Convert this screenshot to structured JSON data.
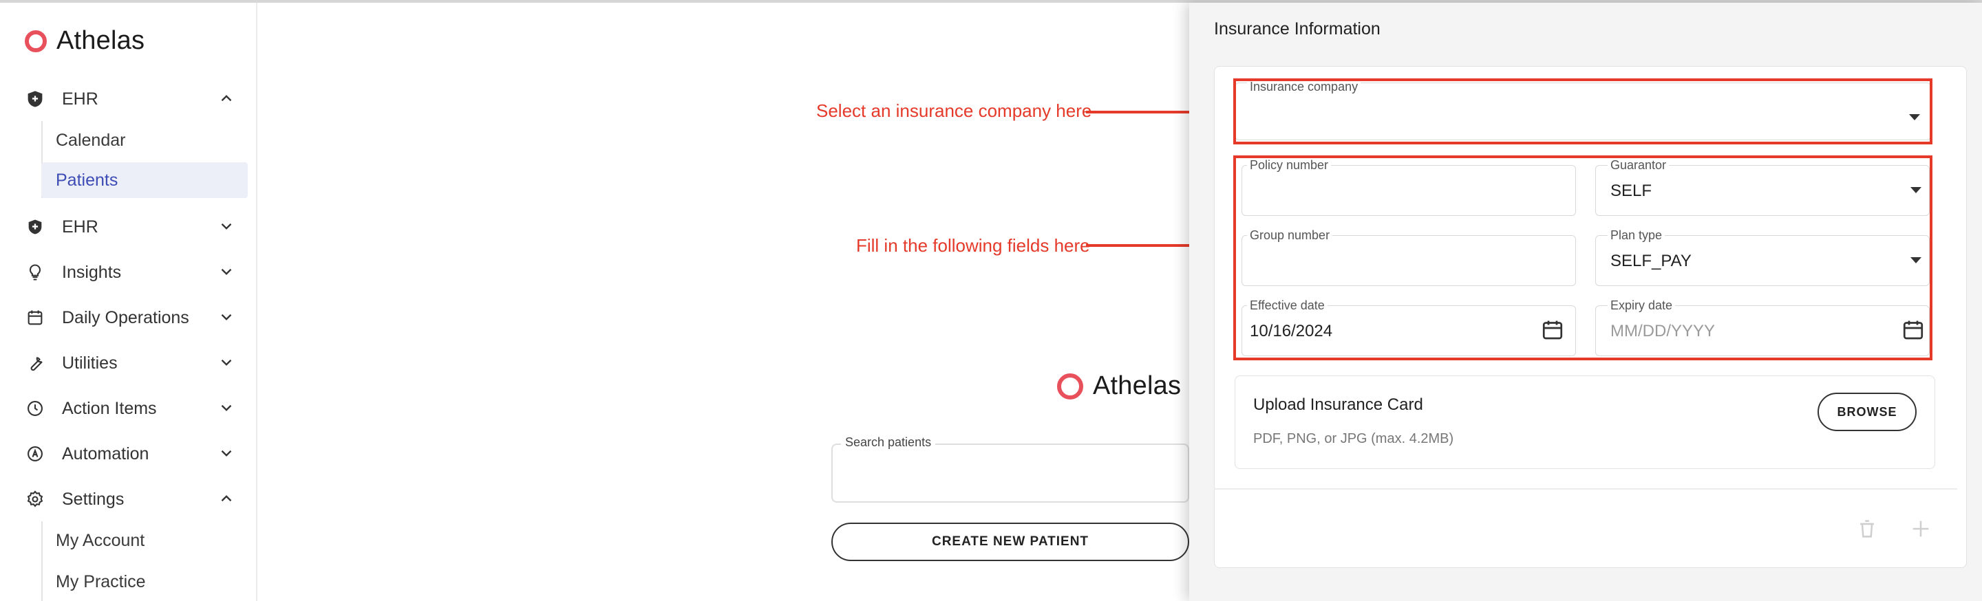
{
  "app": {
    "name": "Athelas"
  },
  "sidebar": {
    "logo_text": "Athelas",
    "items": [
      {
        "label": "EHR",
        "icon": "shield-plus-icon",
        "expanded": true
      },
      {
        "label": "EHR",
        "icon": "shield-plus-icon",
        "expanded": false
      },
      {
        "label": "Insights",
        "icon": "lightbulb-icon",
        "expanded": false
      },
      {
        "label": "Daily Operations",
        "icon": "calendar-icon",
        "expanded": false
      },
      {
        "label": "Utilities",
        "icon": "wrench-icon",
        "expanded": false
      },
      {
        "label": "Action Items",
        "icon": "clock-icon",
        "expanded": false
      },
      {
        "label": "Automation",
        "icon": "automation-icon",
        "expanded": false
      },
      {
        "label": "Settings",
        "icon": "gear-icon",
        "expanded": true
      }
    ],
    "ehr_sub": [
      {
        "label": "Calendar",
        "active": false
      },
      {
        "label": "Patients",
        "active": true
      }
    ],
    "settings_sub": [
      {
        "label": "My Account"
      },
      {
        "label": "My Practice"
      }
    ]
  },
  "main": {
    "logo_text": "Athelas",
    "search_label": "Search patients",
    "search_value": "",
    "create_button": "CREATE NEW PATIENT"
  },
  "annotations": {
    "insurance": "Select an insurance company here",
    "fields": "Fill in the following fields here"
  },
  "drawer": {
    "title": "Insurance Information",
    "insurance_company": {
      "label": "Insurance company",
      "value": ""
    },
    "policy_number": {
      "label": "Policy number",
      "value": ""
    },
    "guarantor": {
      "label": "Guarantor",
      "value": "SELF"
    },
    "group_number": {
      "label": "Group number",
      "value": ""
    },
    "plan_type": {
      "label": "Plan type",
      "value": "SELF_PAY"
    },
    "effective_date": {
      "label": "Effective date",
      "value": "10/16/2024"
    },
    "expiry_date": {
      "label": "Expiry date",
      "placeholder": "MM/DD/YYYY"
    },
    "upload": {
      "title": "Upload Insurance Card",
      "subtitle": "PDF, PNG, or JPG (max. 4.2MB)",
      "browse": "BROWSE"
    }
  },
  "colors": {
    "accent": "#e8505b",
    "annotation": "#e53a2a",
    "active_nav_bg": "#eceef8",
    "active_nav_text": "#3e4db5"
  }
}
